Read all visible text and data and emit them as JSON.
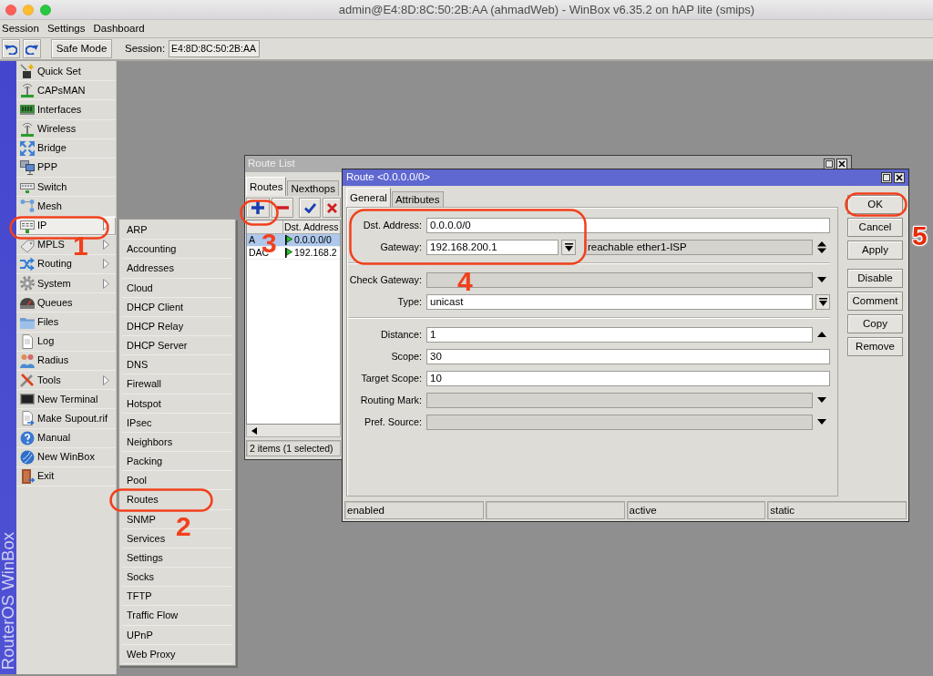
{
  "window": {
    "title": "admin@E4:8D:8C:50:2B:AA (ahmadWeb) - WinBox v6.35.2 on hAP lite (smips)"
  },
  "menu_bar": [
    "Session",
    "Settings",
    "Dashboard"
  ],
  "toolbar": {
    "safe_mode_button": "Safe Mode",
    "session_label": "Session:",
    "session_value": "E4:8D:8C:50:2B:AA"
  },
  "side_banner": "RouterOS WinBox",
  "main_menu": [
    {
      "label": "Quick Set",
      "has_submenu": false,
      "selected": false
    },
    {
      "label": "CAPsMAN",
      "has_submenu": false,
      "selected": false
    },
    {
      "label": "Interfaces",
      "has_submenu": false,
      "selected": false
    },
    {
      "label": "Wireless",
      "has_submenu": false,
      "selected": false
    },
    {
      "label": "Bridge",
      "has_submenu": false,
      "selected": false
    },
    {
      "label": "PPP",
      "has_submenu": false,
      "selected": false
    },
    {
      "label": "Switch",
      "has_submenu": false,
      "selected": false
    },
    {
      "label": "Mesh",
      "has_submenu": false,
      "selected": false
    },
    {
      "label": "IP",
      "has_submenu": true,
      "selected": true
    },
    {
      "label": "MPLS",
      "has_submenu": true,
      "selected": false
    },
    {
      "label": "Routing",
      "has_submenu": true,
      "selected": false
    },
    {
      "label": "System",
      "has_submenu": true,
      "selected": false
    },
    {
      "label": "Queues",
      "has_submenu": false,
      "selected": false
    },
    {
      "label": "Files",
      "has_submenu": false,
      "selected": false
    },
    {
      "label": "Log",
      "has_submenu": false,
      "selected": false
    },
    {
      "label": "Radius",
      "has_submenu": false,
      "selected": false
    },
    {
      "label": "Tools",
      "has_submenu": true,
      "selected": false
    },
    {
      "label": "New Terminal",
      "has_submenu": false,
      "selected": false
    },
    {
      "label": "Make Supout.rif",
      "has_submenu": false,
      "selected": false
    },
    {
      "label": "Manual",
      "has_submenu": false,
      "selected": false
    },
    {
      "label": "New WinBox",
      "has_submenu": false,
      "selected": false
    },
    {
      "label": "Exit",
      "has_submenu": false,
      "selected": false
    }
  ],
  "ip_submenu": [
    "ARP",
    "Accounting",
    "Addresses",
    "Cloud",
    "DHCP Client",
    "DHCP Relay",
    "DHCP Server",
    "DNS",
    "Firewall",
    "Hotspot",
    "IPsec",
    "Neighbors",
    "Packing",
    "Pool",
    "Routes",
    "SNMP",
    "Services",
    "Settings",
    "Socks",
    "TFTP",
    "Traffic Flow",
    "UPnP",
    "Web Proxy"
  ],
  "route_list": {
    "title": "Route List",
    "tabs": [
      {
        "label": "Routes",
        "selected": true
      },
      {
        "label": "Nexthops",
        "selected": false
      }
    ],
    "columns": [
      "Dst. Address"
    ],
    "rows": [
      {
        "column_1": "A",
        "dst_address": "0.0.0.0/0",
        "selected": true
      },
      {
        "column_1": "DAC",
        "dst_address": "192.168.2",
        "selected": false
      }
    ],
    "status": "2 items (1 selected)"
  },
  "route_dialog": {
    "title": "Route <0.0.0.0/0>",
    "tabs": [
      {
        "label": "General",
        "selected": true
      },
      {
        "label": "Attributes",
        "selected": false
      }
    ],
    "field_groups": [
      [
        {
          "kind": "text",
          "label": "Dst. Address:",
          "value": "0.0.0.0/0"
        },
        {
          "kind": "gateway",
          "label": "Gateway:",
          "value": "192.168.200.1",
          "status": "reachable ether1-ISP"
        }
      ],
      [
        {
          "kind": "select",
          "label": "Check Gateway:"
        },
        {
          "kind": "combo",
          "label": "Type:",
          "value": "unicast"
        }
      ],
      [
        {
          "kind": "spin",
          "label": "Distance:",
          "value": "1"
        },
        {
          "kind": "text",
          "label": "Scope:",
          "value": "30"
        },
        {
          "kind": "text",
          "label": "Target Scope:",
          "value": "10"
        },
        {
          "kind": "select",
          "label": "Routing Mark:"
        },
        {
          "kind": "select",
          "label": "Pref. Source:"
        }
      ]
    ],
    "button_groups": [
      [
        "OK",
        "Cancel",
        "Apply"
      ],
      [
        "Disable",
        "Comment",
        "Copy",
        "Remove"
      ]
    ],
    "status_bar": [
      {
        "kind": "text",
        "text": "enabled"
      },
      {
        "kind": "blank"
      },
      {
        "kind": "text",
        "text": "active"
      },
      {
        "kind": "text",
        "text": "static"
      }
    ]
  },
  "callouts": [
    {
      "label": "1"
    },
    {
      "label": "2"
    },
    {
      "label": "3"
    },
    {
      "label": "4"
    },
    {
      "label": "5"
    }
  ]
}
